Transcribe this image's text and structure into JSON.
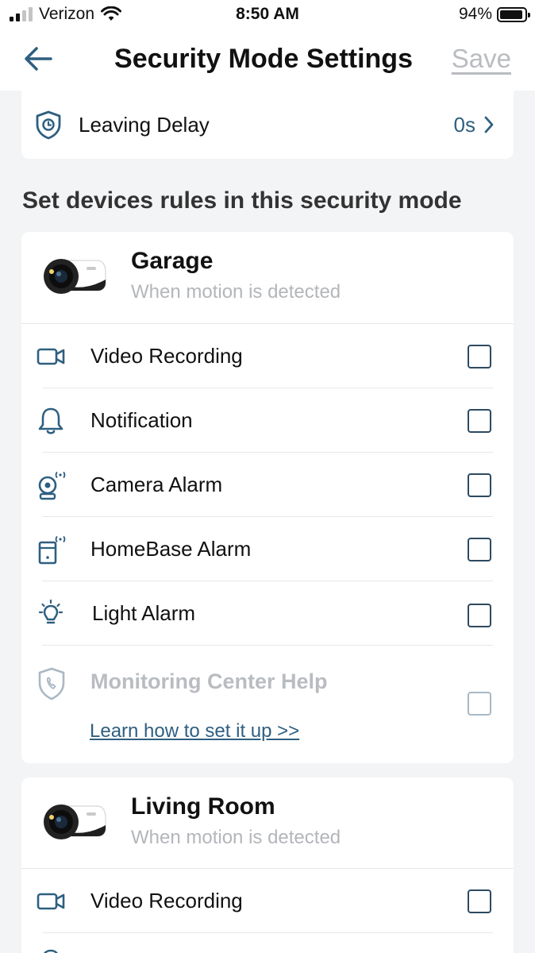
{
  "status_bar": {
    "carrier": "Verizon",
    "time": "8:50 AM",
    "battery": "94%",
    "battery_level": 0.94
  },
  "nav": {
    "title": "Security Mode Settings",
    "save_label": "Save"
  },
  "leaving_delay": {
    "label": "Leaving Delay",
    "value": "0s"
  },
  "section_title": "Set devices rules in this security mode",
  "devices": [
    {
      "name": "Garage",
      "subtitle": "When motion is detected",
      "rules": [
        {
          "label": "Video Recording",
          "icon": "video-camera-icon",
          "checked": false
        },
        {
          "label": "Notification",
          "icon": "bell-icon",
          "checked": false
        },
        {
          "label": "Camera Alarm",
          "icon": "camera-alarm-icon",
          "checked": false
        },
        {
          "label": "HomeBase Alarm",
          "icon": "homebase-alarm-icon",
          "checked": false
        },
        {
          "label": "Light Alarm",
          "icon": "light-bulb-icon",
          "checked": false
        }
      ],
      "monitoring": {
        "label": "Monitoring Center Help",
        "link": "Learn how to set it up >>",
        "icon": "shield-phone-icon",
        "checked": false
      }
    },
    {
      "name": "Living Room",
      "subtitle": "When motion is detected",
      "rules": [
        {
          "label": "Video Recording",
          "icon": "video-camera-icon",
          "checked": false
        }
      ]
    }
  ],
  "colors": {
    "accent": "#2e5f80",
    "checkbox_border": "#2d4a60",
    "muted_text": "#b3b6ba",
    "background": "#f3f4f6"
  }
}
